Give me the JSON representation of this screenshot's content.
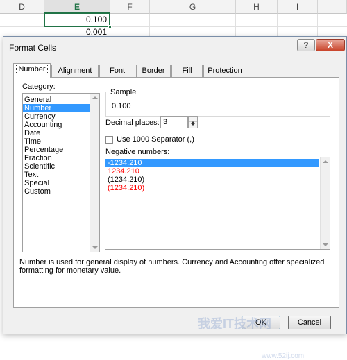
{
  "spreadsheet": {
    "columns": [
      {
        "label": "D"
      },
      {
        "label": "E"
      },
      {
        "label": "F"
      },
      {
        "label": "G"
      },
      {
        "label": "H"
      },
      {
        "label": "I"
      }
    ],
    "cells": [
      "0.100",
      "0.001"
    ]
  },
  "dialog": {
    "title": "Format Cells",
    "help_label": "?",
    "close_label": "X",
    "tabs": [
      "Number",
      "Alignment",
      "Font",
      "Border",
      "Fill",
      "Protection"
    ],
    "active_tab": "Number",
    "category_label": "Category:",
    "categories": [
      "General",
      "Number",
      "Currency",
      "Accounting",
      "Date",
      "Time",
      "Percentage",
      "Fraction",
      "Scientific",
      "Text",
      "Special",
      "Custom"
    ],
    "selected_category": "Number",
    "sample_label": "Sample",
    "sample_value": "0.100",
    "decimal_places_label": "Decimal places:",
    "decimal_places_value": "3",
    "use_separator_label": "Use 1000 Separator (,)",
    "negative_numbers_label": "Negative numbers:",
    "negative_numbers": [
      {
        "text": "-1234.210",
        "color": "#000000"
      },
      {
        "text": "1234.210",
        "color": "#ff0000"
      },
      {
        "text": "(1234.210)",
        "color": "#000000"
      },
      {
        "text": "(1234.210)",
        "color": "#ff0000"
      }
    ],
    "description": "Number is used for general display of numbers.  Currency and Accounting offer specialized formatting for monetary value.",
    "ok_label": "OK",
    "cancel_label": "Cancel"
  },
  "watermark": {
    "text": "我爱IT技术网",
    "sub": "www.52ij.com"
  },
  "colors": {
    "selection": "#3399ff",
    "excel_green": "#217346",
    "negative_red": "#ff0000"
  }
}
